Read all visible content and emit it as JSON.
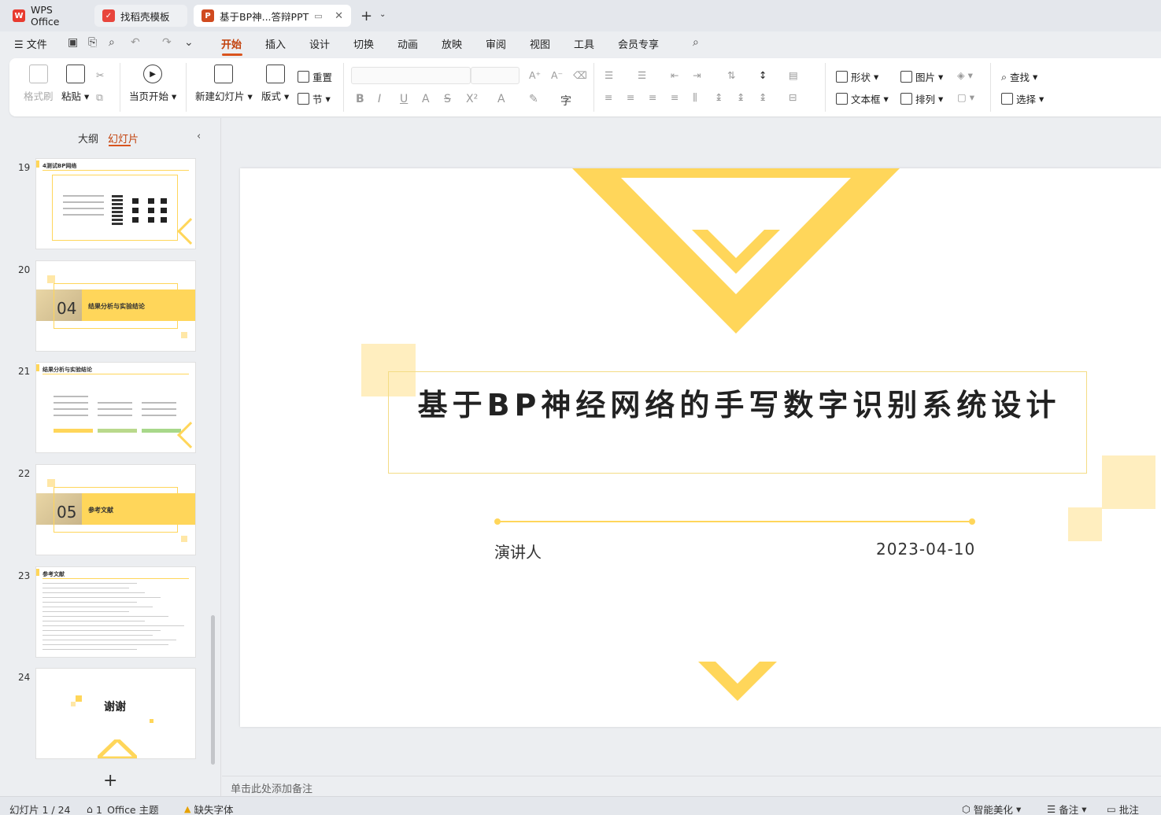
{
  "tabs": [
    {
      "label": "WPS Office",
      "icon": "wps-logo-icon",
      "color": "#e83a2f"
    },
    {
      "label": "找稻壳模板",
      "icon": "docer-logo-icon",
      "color": "#e8453c"
    },
    {
      "label": "基于BP神...答辩PPT",
      "icon": "ppt-logo-icon",
      "color": "#d04a1f"
    }
  ],
  "menu": {
    "file": "文件",
    "items": [
      "开始",
      "插入",
      "设计",
      "切换",
      "动画",
      "放映",
      "审阅",
      "视图",
      "工具",
      "会员专享"
    ],
    "active": "开始"
  },
  "ribbon": {
    "format_painter": "格式刷",
    "paste": "粘贴",
    "start_from_current": "当页开始",
    "new_slide": "新建幻灯片",
    "layout": "版式",
    "section": "节",
    "reset": "重置",
    "shape": "形状",
    "picture": "图片",
    "textbox": "文本框",
    "arrange": "排列",
    "find": "查找",
    "select": "选择"
  },
  "left_panel": {
    "tab_outline": "大纲",
    "tab_slides": "幻灯片",
    "thumbnails": [
      {
        "num": "19",
        "title": "4测试BP网络"
      },
      {
        "num": "20",
        "section_num": "04",
        "title": "结果分析与实验结论"
      },
      {
        "num": "21",
        "title": "结果分析与实验结论"
      },
      {
        "num": "22",
        "section_num": "05",
        "title": "参考文献"
      },
      {
        "num": "23",
        "title": "参考文献"
      },
      {
        "num": "24",
        "title": "谢谢"
      }
    ]
  },
  "slide": {
    "title": "基于BP神经网络的手写数字识别系统设计",
    "speaker_label": "演讲人",
    "date": "2023-04-10",
    "accent_color": "#ffd65a",
    "light_accent_color": "#ffeebf"
  },
  "notes_placeholder": "单击此处添加备注",
  "status": {
    "slide_counter": "幻灯片 1 / 24",
    "theme": "1_Office 主题",
    "missing_fonts": "缺失字体",
    "smart_beautify": "智能美化",
    "notes": "备注",
    "comments": "批注"
  }
}
